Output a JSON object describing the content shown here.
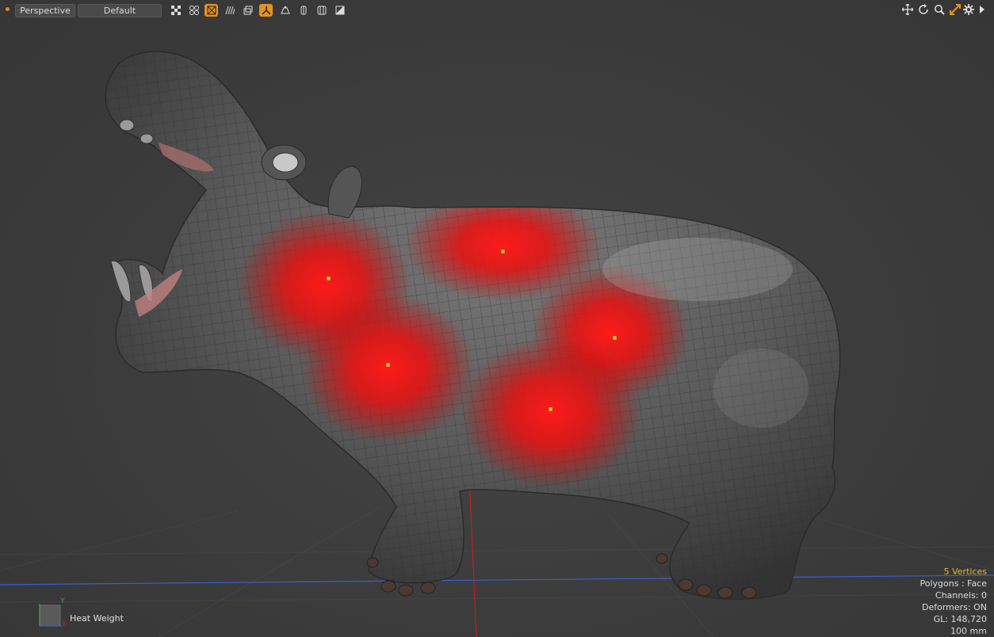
{
  "toolbar": {
    "view_mode": "Perspective",
    "shading_preset": "Default",
    "icons": [
      {
        "name": "checker-icon",
        "active": false
      },
      {
        "name": "grid-icon",
        "active": false
      },
      {
        "name": "wireframe-icon",
        "active": true
      },
      {
        "name": "hatch-icon",
        "active": false
      },
      {
        "name": "frame-icon",
        "active": false
      },
      {
        "name": "deformer-icon",
        "active": true
      },
      {
        "name": "weight-icon",
        "active": false
      },
      {
        "name": "half-icon",
        "active": false
      },
      {
        "name": "split-icon",
        "active": false
      },
      {
        "name": "slash-icon",
        "active": false
      }
    ],
    "nav_icons": [
      "move-view-icon",
      "rotate-view-icon",
      "zoom-view-icon",
      "fit-view-icon",
      "settings-icon",
      "more-icon"
    ]
  },
  "info": {
    "selection": "5 Vertices",
    "polygons": "Polygons : Face",
    "channels": "Channels: 0",
    "deformers": "Deformers: ON",
    "gl": "GL: 148,720",
    "scale": "100 mm"
  },
  "axis": {
    "y_label": "Y",
    "x_label": "X"
  },
  "layer_label": "Heat Weight",
  "colors": {
    "accent": "#e5931f",
    "highlight_text": "#e8b830",
    "weight_red": "#ff1a1a",
    "mesh_gray": "#5a5a5a",
    "axis_blue": "#3a5fd0",
    "axis_red": "#c02020"
  },
  "selected_vertices": 5
}
